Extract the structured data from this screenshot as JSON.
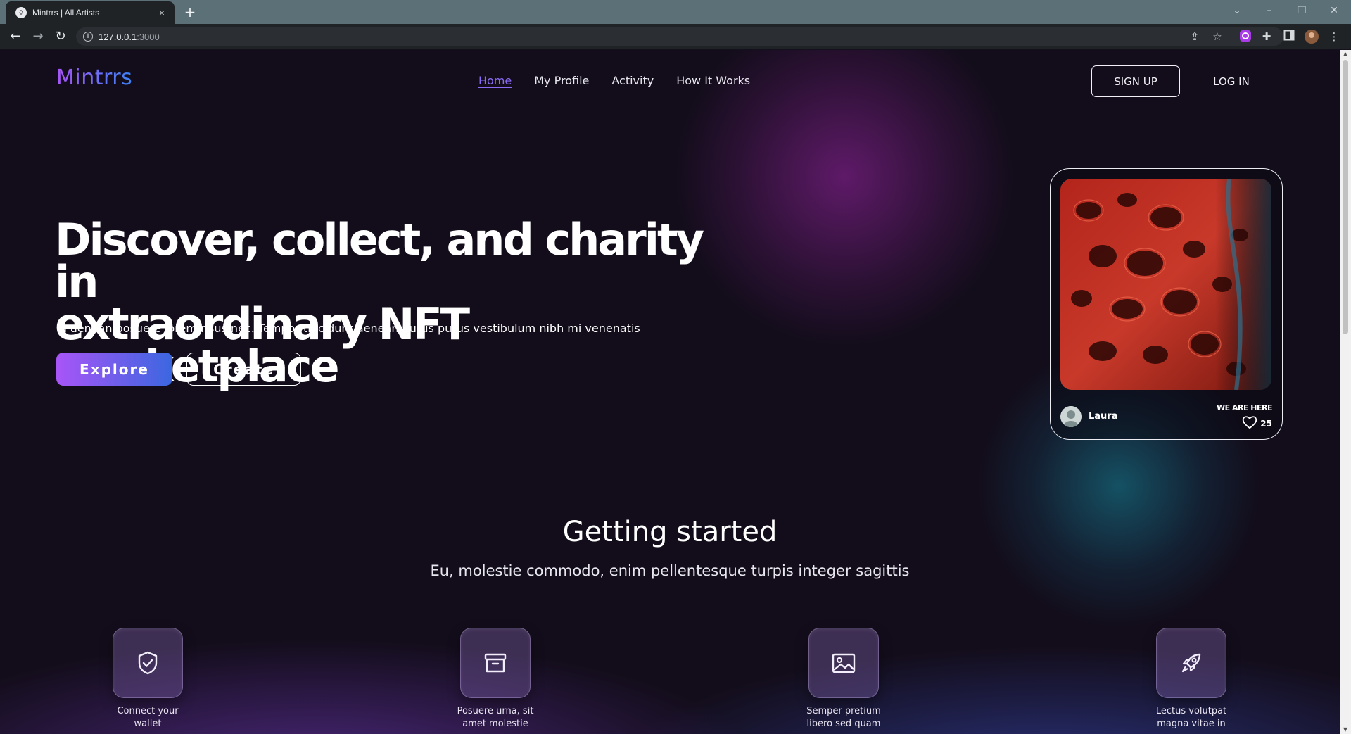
{
  "browser": {
    "tab_title": "Mintrrs | All Artists",
    "tab_close": "×",
    "new_tab": "+",
    "url_host": "127.0.0.1",
    "url_port": ":3000"
  },
  "site": {
    "logo": "Mintrrs",
    "nav": [
      {
        "label": "Home",
        "active": true
      },
      {
        "label": "My Profile",
        "active": false
      },
      {
        "label": "Activity",
        "active": false
      },
      {
        "label": "How It Works",
        "active": false
      }
    ],
    "signup": "SIGN UP",
    "login": "LOG IN"
  },
  "hero": {
    "title_line1": "Discover, collect, and charity in",
    "title_line2": "extraordinary NFT marketplace",
    "subtitle": "In aenean posuere lorem risus nec. Tempor tincidunt aenean purus purus vestibulum nibh mi venenatis",
    "explore_label": "Explore",
    "create_label": "Create"
  },
  "featured_card": {
    "owner": "Laura",
    "tag": "WE ARE HERE",
    "likes": "25"
  },
  "getting_started": {
    "title": "Getting started",
    "subtitle": "Eu, molestie commodo, enim pellentesque turpis integer sagittis",
    "steps": [
      {
        "icon": "shield-check-icon",
        "label_l1": "Connect your",
        "label_l2": "wallet"
      },
      {
        "icon": "archive-box-icon",
        "label_l1": "Posuere urna, sit",
        "label_l2": "amet molestie"
      },
      {
        "icon": "image-icon",
        "label_l1": "Semper pretium",
        "label_l2": "libero sed quam"
      },
      {
        "icon": "rocket-icon",
        "label_l1": "Lectus volutpat",
        "label_l2": "magna vitae in"
      }
    ]
  },
  "colors": {
    "background": "#130d1b",
    "accent_purple": "#a855f7",
    "accent_blue": "#3b82f6",
    "nav_active": "#8b6cf6"
  }
}
